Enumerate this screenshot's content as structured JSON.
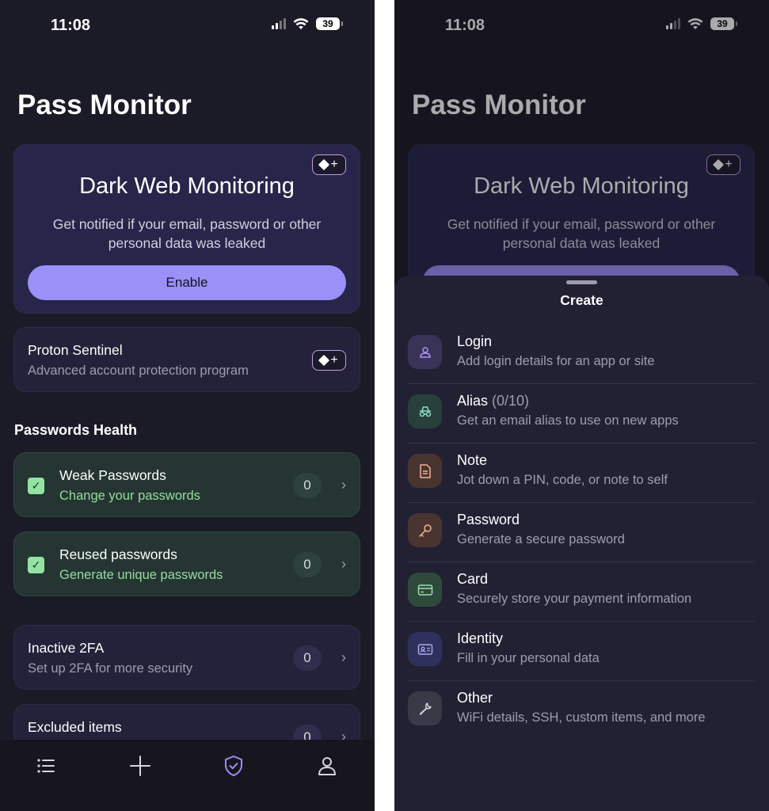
{
  "status": {
    "time": "11:08",
    "battery": "39"
  },
  "left": {
    "title": "Pass Monitor",
    "dark_web": {
      "title": "Dark Web Monitoring",
      "description": "Get notified if your email, password or other personal data was leaked",
      "button": "Enable"
    },
    "sentinel": {
      "title": "Proton Sentinel",
      "subtitle": "Advanced account protection program"
    },
    "section": "Passwords Health",
    "rows": [
      {
        "title": "Weak Passwords",
        "subtitle": "Change your passwords",
        "count": "0"
      },
      {
        "title": "Reused passwords",
        "subtitle": "Generate unique passwords",
        "count": "0"
      },
      {
        "title": "Inactive 2FA",
        "subtitle": "Set up 2FA for more security",
        "count": "0"
      },
      {
        "title": "Excluded items",
        "subtitle": "",
        "count": "0"
      }
    ],
    "tabs": [
      "list-icon",
      "plus-icon",
      "shield-check-icon",
      "profile-icon"
    ]
  },
  "right": {
    "sheet_title": "Create",
    "items": [
      {
        "title": "Login",
        "suffix": "",
        "subtitle": "Add login details for an app or site",
        "icon": "user-icon",
        "icon_bg": "#3a3358",
        "icon_color": "#a995f4"
      },
      {
        "title": "Alias",
        "suffix": "(0/10)",
        "subtitle": "Get an email alias to use on new apps",
        "icon": "incognito-icon",
        "icon_bg": "#27403c",
        "icon_color": "#8fd9cb"
      },
      {
        "title": "Note",
        "suffix": "",
        "subtitle": "Jot down a PIN, code, or note to self",
        "icon": "note-icon",
        "icon_bg": "#4a3430",
        "icon_color": "#f0b49a"
      },
      {
        "title": "Password",
        "suffix": "",
        "subtitle": "Generate a secure password",
        "icon": "key-icon",
        "icon_bg": "#4a3430",
        "icon_color": "#f0b49a"
      },
      {
        "title": "Card",
        "suffix": "",
        "subtitle": "Securely store your payment information",
        "icon": "credit-card-icon",
        "icon_bg": "#2f4a3b",
        "icon_color": "#9edcb0"
      },
      {
        "title": "Identity",
        "suffix": "",
        "subtitle": "Fill in your personal data",
        "icon": "id-card-icon",
        "icon_bg": "#30305c",
        "icon_color": "#a8a8f0"
      },
      {
        "title": "Other",
        "suffix": "",
        "subtitle": "WiFi details, SSH, custom items, and more",
        "icon": "wrench-icon",
        "icon_bg": "#3a3947",
        "icon_color": "#d6d5df"
      }
    ]
  },
  "colors": {
    "background": "#1b1a27",
    "accent": "#9a90f8",
    "success": "#95e3a2"
  }
}
